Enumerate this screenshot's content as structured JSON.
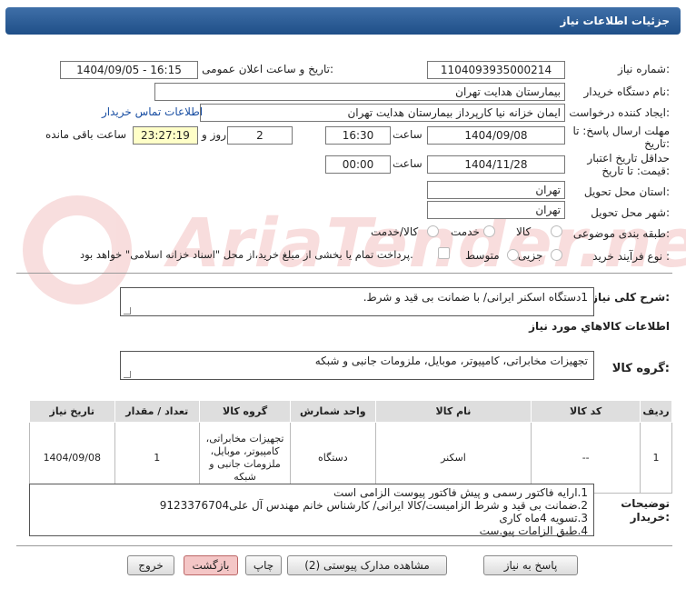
{
  "header": {
    "title": "جزئیات اطلاعات نیاز"
  },
  "fields": {
    "need_number_label": "شماره نیاز:",
    "need_number": "1104093935000214",
    "announce_label": "تاریخ و ساعت اعلان عمومی:",
    "announce_value": "1404/09/05 - 16:15",
    "buyer_label": "نام دستگاه خریدار:",
    "buyer_value": "بیمارستان هدایت تهران",
    "creator_label": "ایجاد کننده درخواست:",
    "creator_value": "ایمان خزانه نیا کارپرداز بیمارستان هدایت تهران",
    "contact_link": "اطلاعات تماس خریدار",
    "deadline_label_1": "مهلت ارسال پاسخ: تا",
    "deadline_label_2": "تاریخ:",
    "deadline_date": "1404/09/08",
    "time_label": "ساعت",
    "deadline_time": "16:30",
    "days_value": "2",
    "days_label": "روز و",
    "remaining_value": "23:27:19",
    "remaining_label": "ساعت باقی مانده",
    "validity_label_1": "حداقل تاریخ اعتبار",
    "validity_label_2": "قیمت: تا تاریخ:",
    "validity_date": "1404/11/28",
    "validity_time": "00:00",
    "province_label": "استان محل تحویل:",
    "province_value": "تهران",
    "city_label": "شهر محل تحویل:",
    "city_value": "تهران",
    "category_label": "طبقه بندی موضوعی:",
    "category_options": [
      "کالا",
      "خدمت",
      "کالا/خدمت"
    ],
    "process_label": "نوع فرآیند خرید :",
    "process_options": [
      "جزیی",
      "متوسط"
    ],
    "payment_note": "پرداخت تمام یا بخشی از مبلغ خرید،از محل \"اسناد خزانه اسلامی\" خواهد بود."
  },
  "description": {
    "label": "شرح کلی نیاز:",
    "value": "1دستگاه اسکنر ایرانی/ با ضمانت بی قید و شرط."
  },
  "goods_info": {
    "heading": "اطلاعات کالاهاي مورد نياز",
    "group_label": "گروه کالا:",
    "group_value": "تجهیزات مخابراتی، کامپیوتر، موبایل، ملزومات جانبی و شبکه"
  },
  "table": {
    "headers": [
      "ردیف",
      "کد کالا",
      "نام کالا",
      "واحد شمارش",
      "گروه کالا",
      "تعداد / مقدار",
      "تاریخ نیاز"
    ],
    "rows": [
      [
        "1",
        "--",
        "اسکنر",
        "دستگاه",
        "تجهیزات مخابراتی، کامپیوتر، موبایل، ملزومات جانبی و شبکه",
        "1",
        "1404/09/08"
      ]
    ]
  },
  "buyer_notes": {
    "label_1": "توضیحات",
    "label_2": "خریدار:",
    "lines": [
      "1.ارایه فاکتور رسمی و پیش فاکتور پیوست الزامی است",
      "2.ضمانت بی قید و شرط الزامیست/کالا ایرانی/ کارشناس خانم مهندس آل علی9123376704",
      "3.تسویه 4ماه کاری",
      "4.طبق الزامات پیو.ست"
    ]
  },
  "buttons": {
    "reply": "پاسخ به نیاز",
    "attachments": "مشاهده مدارک پیوستی (2)",
    "print": "چاپ",
    "back": "بازگشت",
    "exit": "خروج"
  },
  "colors": {
    "title_bar": "#2b5c96",
    "link": "#1a4fa3",
    "remaining_bg": "#ffffc8",
    "back_button": "#f4c6c6"
  }
}
